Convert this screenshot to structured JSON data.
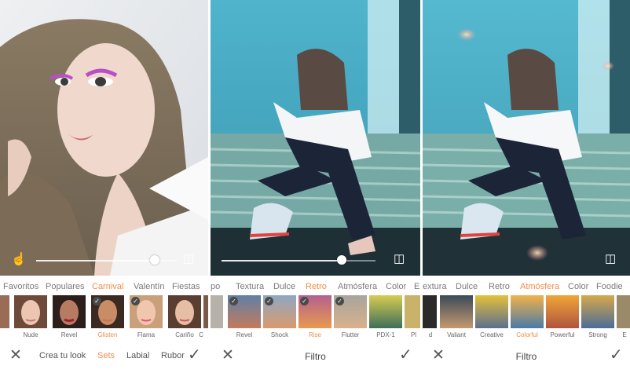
{
  "panel1": {
    "categories": [
      "Favoritos",
      "Populares",
      "Carnival",
      "Valentín",
      "Fiestas"
    ],
    "active_category": "Carnival",
    "thumbs": [
      "",
      "Nude",
      "Revel",
      "Glisten",
      "Flama",
      "Cariño",
      "C"
    ],
    "active_thumb": "Glisten",
    "bottom_tabs": [
      "Crea tu look",
      "Sets",
      "Labial",
      "Rubor"
    ],
    "active_tab": "Sets"
  },
  "panel2": {
    "categories": [
      "po",
      "Textura",
      "Dulce",
      "Retro",
      "Atmósfera",
      "Color",
      "E"
    ],
    "active_category": "Retro",
    "thumbs": [
      "",
      "Revel",
      "Shock",
      "Rise",
      "Flutter",
      "PDX-1",
      "Pl"
    ],
    "active_thumb": "Rise",
    "title": "Filtro"
  },
  "panel3": {
    "categories": [
      "extura",
      "Dulce",
      "Retro",
      "Atmósfera",
      "Color",
      "Foodie"
    ],
    "active_category": "Atmósfera",
    "thumbs": [
      "d",
      "Valiant",
      "Creative",
      "Colorful",
      "Powerful",
      "Strong",
      "E"
    ],
    "active_thumb": "Colorful",
    "title": "Filtro"
  },
  "icons": {
    "hand": "hand-touch-icon",
    "compare": "compare-icon",
    "close": "close-icon",
    "check": "checkmark-icon"
  },
  "colors": {
    "accent": "#f28c45",
    "text": "#555555",
    "check_badge": "#4a4a4a"
  }
}
